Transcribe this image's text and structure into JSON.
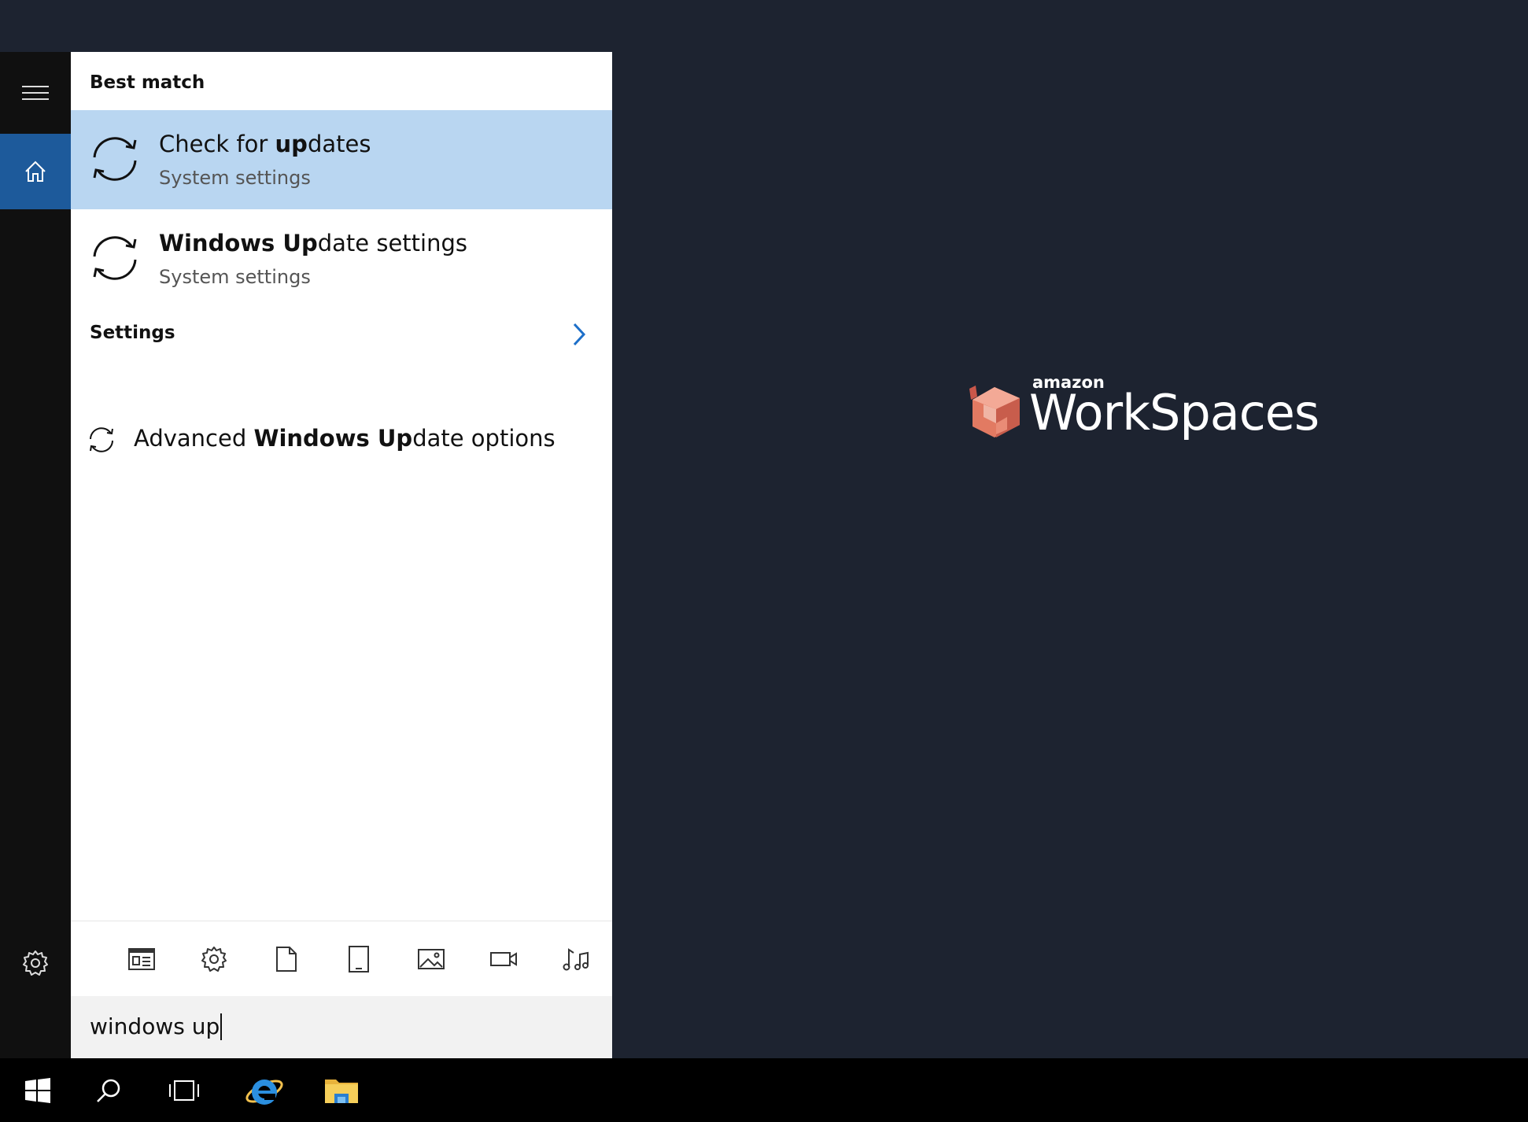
{
  "search": {
    "best_match_header": "Best match",
    "results": [
      {
        "title_pre": "Check for ",
        "title_bold": "up",
        "title_post": "dates",
        "subtitle": "System settings",
        "icon": "sync-icon",
        "selected": true
      },
      {
        "title_pre": "",
        "title_bold": "Windows Up",
        "title_post": "date settings",
        "subtitle": "System settings",
        "icon": "sync-icon",
        "selected": false
      }
    ],
    "settings_header": "Settings",
    "settings_item": {
      "title_pre": "Advanced ",
      "title_bold": "Windows Up",
      "title_post": "date options",
      "icon": "sync-small-icon"
    },
    "query": "windows up",
    "filters": [
      "apps-filter-icon",
      "settings-filter-icon",
      "documents-filter-icon",
      "tablet-filter-icon",
      "photos-filter-icon",
      "videos-filter-icon",
      "music-filter-icon"
    ]
  },
  "rail": {
    "items": [
      "hamburger-icon",
      "home-icon",
      "gear-icon"
    ]
  },
  "logo": {
    "small": "amazon",
    "large": "WorkSpaces",
    "cube_color": "#e27a62"
  },
  "taskbar": {
    "items": [
      "windows-start-icon",
      "search-icon",
      "task-view-icon",
      "internet-explorer-icon",
      "file-explorer-icon"
    ]
  },
  "colors": {
    "desktop": "#1d2330",
    "rail": "#101010",
    "home_active": "#1d5a9b",
    "selected_result": "#b9d6f1",
    "searchbox": "#f2f2f2"
  }
}
